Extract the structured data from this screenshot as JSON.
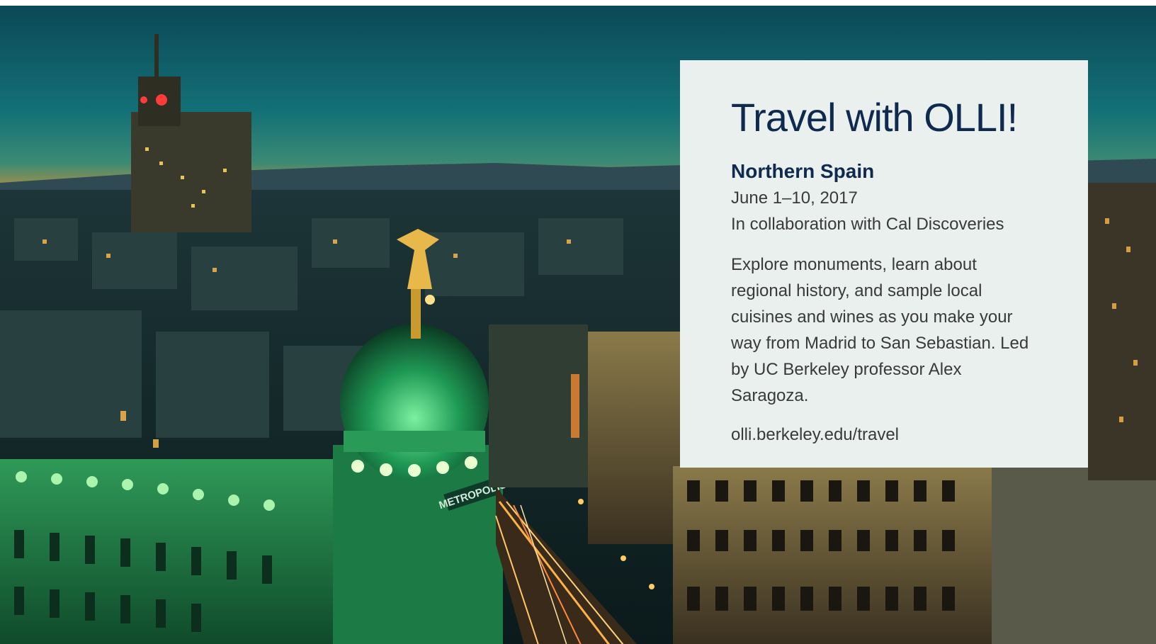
{
  "card": {
    "title": "Travel with OLLI!",
    "trip_name": "Northern Spain",
    "dates": "June 1–10, 2017",
    "collaboration": "In collaboration with Cal Discoveries",
    "description": "Explore monuments, learn about regional history, and sample local cuisines and wines as you make your way from Madrid to San Sebastian. Led by UC Berkeley professor Alex Saragoza.",
    "link": "olli.berkeley.edu/travel"
  },
  "photo": {
    "building_sign": "METROPOLIS"
  },
  "colors": {
    "card_background": "#e9f0ee",
    "title_navy": "#0f2a4e",
    "body_text": "#3a3a3a",
    "sky_teal": "#0f5c63",
    "dome_green": "#3fd17a",
    "street_light": "#f5a623"
  }
}
